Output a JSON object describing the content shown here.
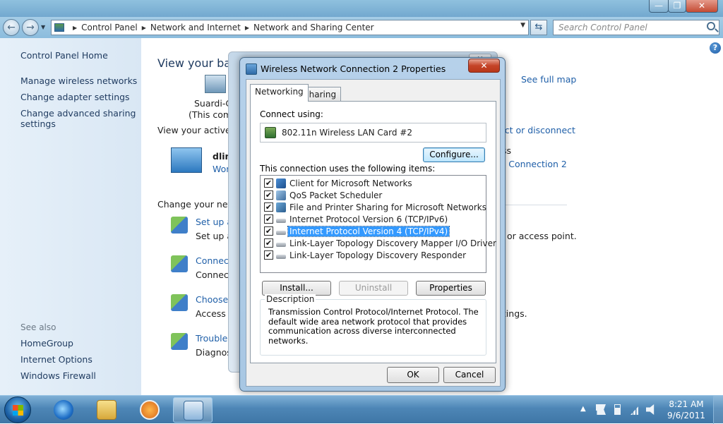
{
  "explorer": {
    "breadcrumb": [
      "Control Panel",
      "Network and Internet",
      "Network and Sharing Center"
    ],
    "search_placeholder": "Search Control Panel",
    "window_buttons": {
      "minimize": "—",
      "maximize": "❐",
      "close": "✕"
    }
  },
  "left_pane": {
    "links": [
      "Control Panel Home",
      "Manage wireless networks",
      "Change adapter settings",
      "Change advanced sharing settings"
    ],
    "see_also_label": "See also",
    "see_also": [
      "HomeGroup",
      "Internet Options",
      "Windows Firewall"
    ]
  },
  "main_pane": {
    "title": "View your bas",
    "see_full_map": "See full map",
    "pc_name": "Suardi-C",
    "pc_sub": "(This comp",
    "active_label": "View your active ne",
    "connect_disconnect": "ect or disconnect",
    "network_name": "dlink",
    "network_type": "Wor",
    "ss_fragment": "ss",
    "connection_link": "k Connection 2",
    "change_label": "Change your netwo",
    "tasks": [
      {
        "link": "Set up a",
        "desc": "Set up a",
        "tail": "or access point."
      },
      {
        "link": "Connect",
        "desc": "Connect",
        "tail": ""
      },
      {
        "link": "Choose h",
        "desc": "Access fi",
        "tail": "ttings."
      },
      {
        "link": "Troubles",
        "desc": "Diagnose",
        "tail": ""
      }
    ]
  },
  "dialog": {
    "title": "Wireless Network Connection 2 Properties",
    "close_glyph": "✕",
    "tabs": [
      "Networking",
      "Sharing"
    ],
    "connect_using_label": "Connect using:",
    "adapter": "802.11n Wireless LAN Card #2",
    "configure_label": "Configure...",
    "items_label": "This connection uses the following items:",
    "items": [
      {
        "label": "Client for Microsoft Networks",
        "checked": true,
        "icon": "client-icon"
      },
      {
        "label": "QoS Packet Scheduler",
        "checked": true,
        "icon": "qos-icon"
      },
      {
        "label": "File and Printer Sharing for Microsoft Networks",
        "checked": true,
        "icon": "share-icon"
      },
      {
        "label": "Internet Protocol Version 6 (TCP/IPv6)",
        "checked": true,
        "icon": "protocol-icon"
      },
      {
        "label": "Internet Protocol Version 4 (TCP/IPv4)",
        "checked": true,
        "icon": "protocol-icon",
        "selected": true
      },
      {
        "label": "Link-Layer Topology Discovery Mapper I/O Driver",
        "checked": true,
        "icon": "protocol-icon"
      },
      {
        "label": "Link-Layer Topology Discovery Responder",
        "checked": true,
        "icon": "protocol-icon"
      }
    ],
    "install_label": "Install...",
    "uninstall_label": "Uninstall",
    "properties_label": "Properties",
    "description_legend": "Description",
    "description_text": "Transmission Control Protocol/Internet Protocol. The default wide area network protocol that provides communication across diverse interconnected networks.",
    "ok_label": "OK",
    "cancel_label": "Cancel"
  },
  "taskbar": {
    "time": "8:21 AM",
    "date": "9/6/2011"
  }
}
